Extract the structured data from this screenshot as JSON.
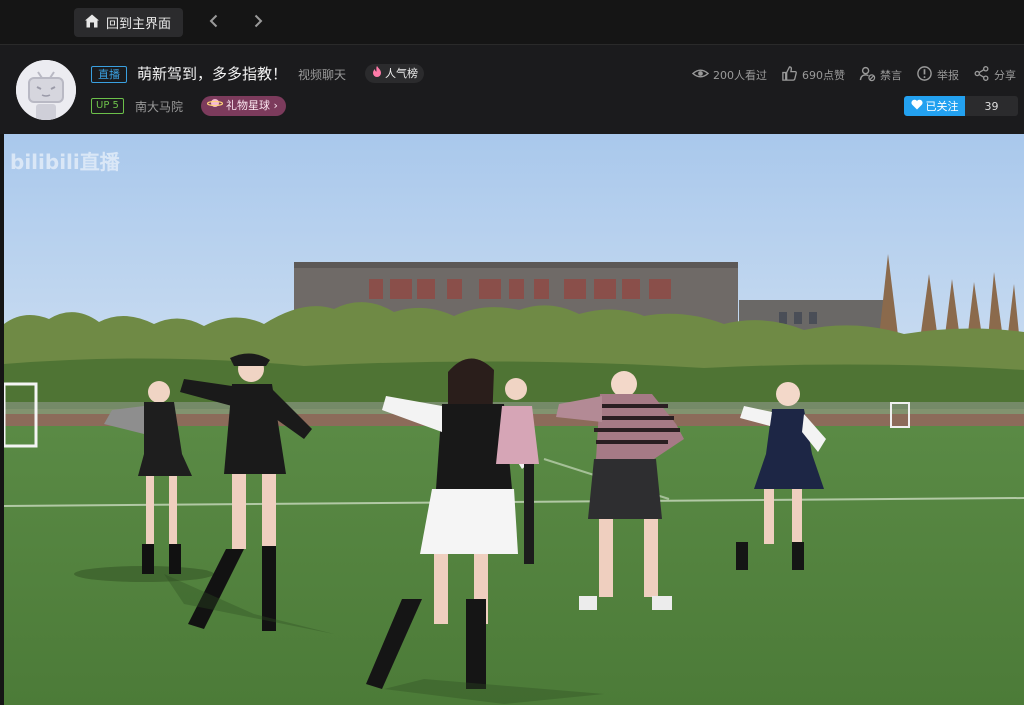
{
  "topbar": {
    "home_label": "回到主界面",
    "back_glyph": "‹",
    "forward_glyph": "›"
  },
  "room": {
    "live_badge": "直播",
    "title": "萌新驾到，多多指教！",
    "category": "视频聊天",
    "popularity_label": "人气榜",
    "up_level": "UP 5",
    "area": "南大马院",
    "gift_label": "礼物星球 ›"
  },
  "stats": {
    "viewers": "200人看过",
    "likes": "690点赞",
    "mute": "禁言",
    "report": "举报",
    "share": "分享"
  },
  "follow": {
    "label": "已关注",
    "count": "39"
  },
  "player": {
    "watermark": "bilibili直播"
  },
  "colors": {
    "accent_blue": "#23a1f0",
    "live_blue": "#3aa0e0",
    "up_green": "#6cc04a",
    "gift_pink": "#7c3b5c",
    "bg_dark": "#151515"
  }
}
